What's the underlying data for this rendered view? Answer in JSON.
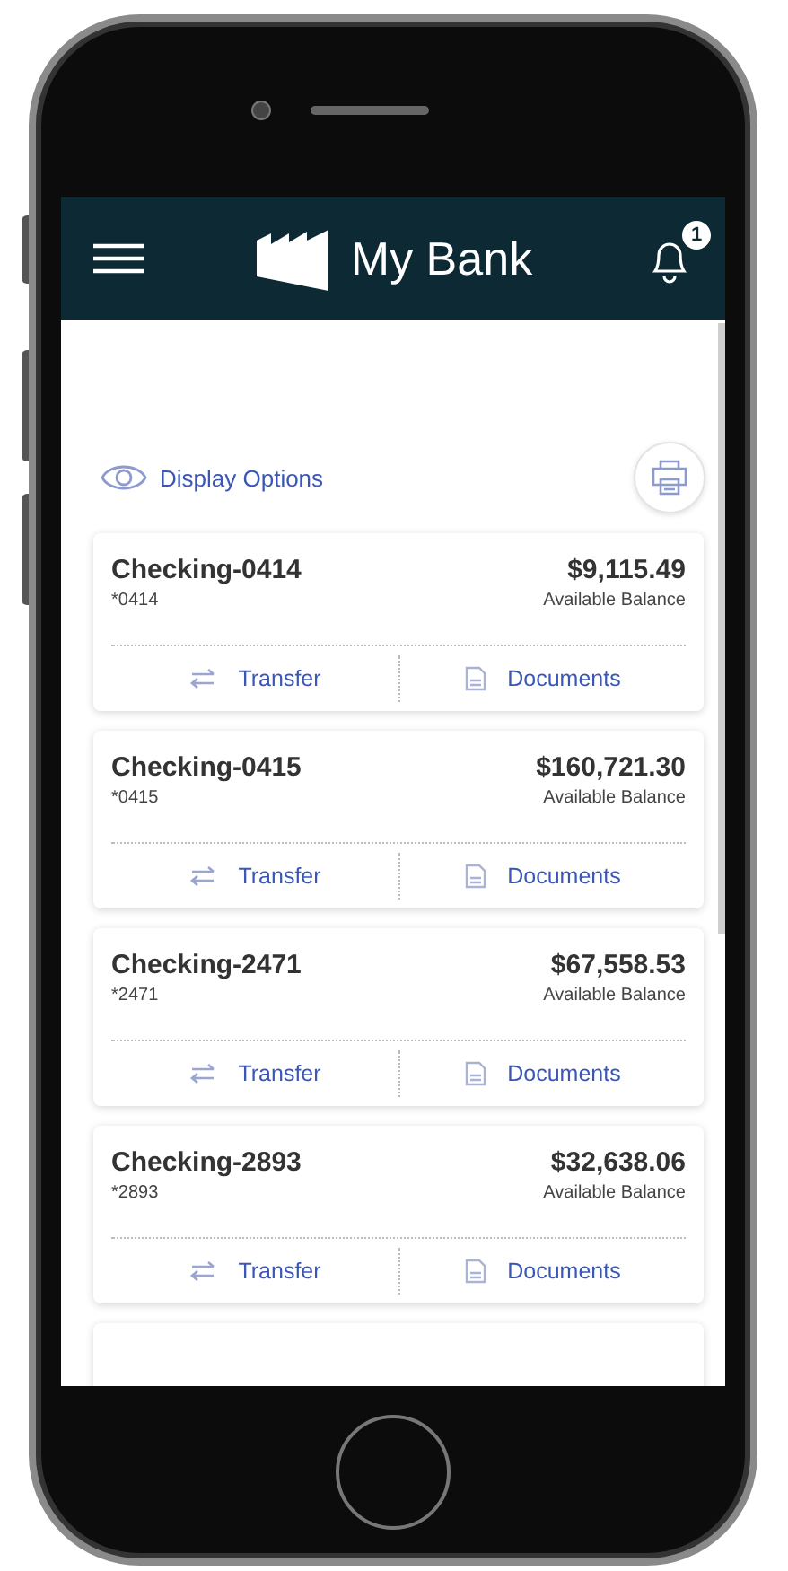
{
  "app": {
    "title": "My Bank",
    "notification_count": "1"
  },
  "display_options": "Display Options",
  "accounts": [
    {
      "name": "Checking-0414",
      "number": "*0414",
      "balance": "$9,115.49",
      "balance_label": "Available Balance",
      "actions": [
        {
          "kind": "transfer",
          "label": "Transfer"
        },
        {
          "kind": "documents",
          "label": "Documents"
        }
      ]
    },
    {
      "name": "Checking-0415",
      "number": "*0415",
      "balance": "$160,721.30",
      "balance_label": "Available Balance",
      "actions": [
        {
          "kind": "transfer",
          "label": "Transfer"
        },
        {
          "kind": "documents",
          "label": "Documents"
        }
      ]
    },
    {
      "name": "Checking-2471",
      "number": "*2471",
      "balance": "$67,558.53",
      "balance_label": "Available Balance",
      "actions": [
        {
          "kind": "transfer",
          "label": "Transfer"
        },
        {
          "kind": "documents",
          "label": "Documents"
        }
      ]
    },
    {
      "name": "Checking-2893",
      "number": "*2893",
      "balance": "$32,638.06",
      "balance_label": "Available Balance",
      "actions": [
        {
          "kind": "transfer",
          "label": "Transfer"
        },
        {
          "kind": "documents",
          "label": "Documents"
        }
      ]
    }
  ]
}
